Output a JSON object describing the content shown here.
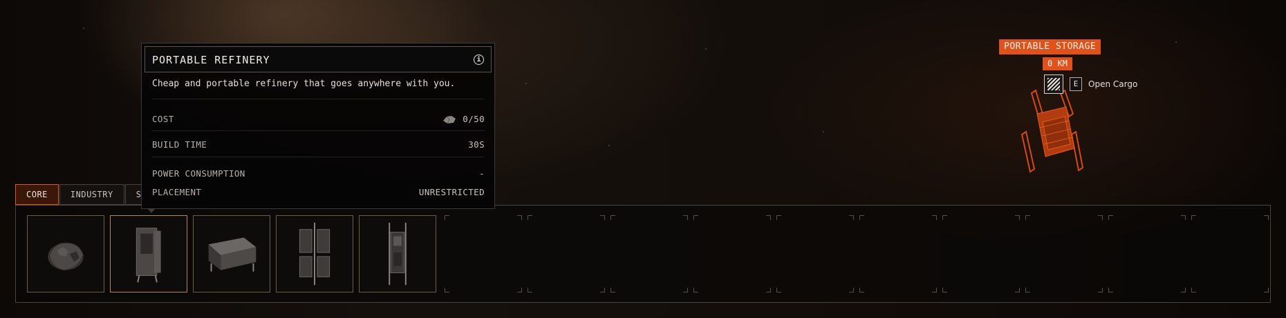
{
  "tabs": [
    {
      "label": "CORE",
      "active": true
    },
    {
      "label": "INDUSTRY",
      "active": false
    },
    {
      "label": "S",
      "active": false
    }
  ],
  "tooltip": {
    "title": "PORTABLE REFINERY",
    "info_icon": "info-icon",
    "description": "Cheap and portable refinery that goes anywhere with you.",
    "rows": {
      "cost_label": "COST",
      "cost_icon": "ore-chunk-icon",
      "cost_value": "0/50",
      "build_time_label": "BUILD TIME",
      "build_time_value": "30S",
      "power_label": "POWER CONSUMPTION",
      "power_value": "-",
      "placement_label": "PLACEMENT",
      "placement_value": "UNRESTRICTED"
    }
  },
  "slots": [
    {
      "icon": "ore-deposit-icon",
      "filled": true
    },
    {
      "icon": "portable-refinery-icon",
      "filled": true,
      "hover": true
    },
    {
      "icon": "portable-storage-icon",
      "filled": true
    },
    {
      "icon": "solar-array-icon",
      "filled": true
    },
    {
      "icon": "antenna-tower-icon",
      "filled": true
    },
    {
      "filled": false
    },
    {
      "filled": false
    },
    {
      "filled": false
    },
    {
      "filled": false
    },
    {
      "filled": false
    },
    {
      "filled": false
    },
    {
      "filled": false
    },
    {
      "filled": false
    },
    {
      "filled": false
    },
    {
      "filled": false
    }
  ],
  "world_marker": {
    "title": "PORTABLE STORAGE",
    "distance": "0 KM",
    "key": "E",
    "action": "Open Cargo",
    "icon": "cargo-crate-icon",
    "color": "#e0521c"
  },
  "colors": {
    "accent": "#e0571f",
    "active_tab_bg": "#3a1708"
  }
}
